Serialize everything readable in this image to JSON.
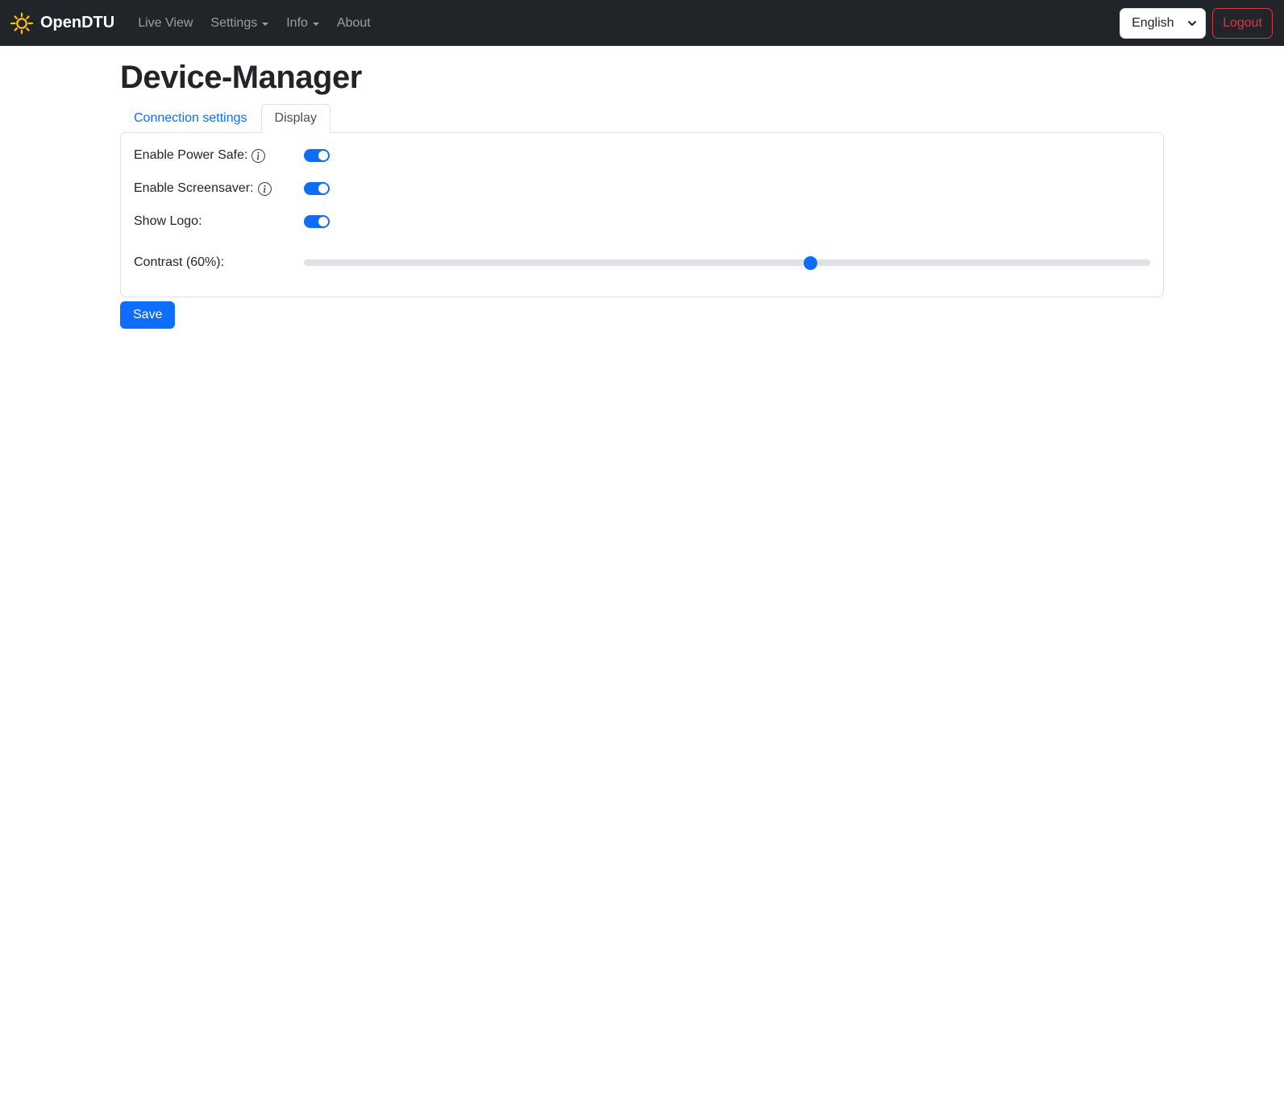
{
  "navbar": {
    "brand": "OpenDTU",
    "items": [
      {
        "label": "Live View",
        "dropdown": false
      },
      {
        "label": "Settings",
        "dropdown": true
      },
      {
        "label": "Info",
        "dropdown": true
      },
      {
        "label": "About",
        "dropdown": false
      }
    ],
    "language": {
      "selected": "English"
    },
    "logout_label": "Logout"
  },
  "page": {
    "title": "Device-Manager"
  },
  "tabs": [
    {
      "label": "Connection settings",
      "active": false
    },
    {
      "label": "Display",
      "active": true
    }
  ],
  "form": {
    "fields": [
      {
        "label": "Enable Power Safe:",
        "type": "switch",
        "value": true,
        "has_info": true
      },
      {
        "label": "Enable Screensaver:",
        "type": "switch",
        "value": true,
        "has_info": true
      },
      {
        "label": "Show Logo:",
        "type": "switch",
        "value": true,
        "has_info": false
      },
      {
        "label": "Contrast (60%):",
        "type": "range",
        "value": 60,
        "min": 0,
        "max": 100
      }
    ],
    "save_label": "Save"
  },
  "icons": {
    "brand": "sun-icon",
    "nav_dropdown": "chevron-down-icon",
    "field_help": "info-circle-icon"
  },
  "colors": {
    "accent": "#0d6efd",
    "danger": "#dc3545",
    "navbar_bg": "#212529",
    "border": "#dee2e6",
    "text": "#212529",
    "sun": "#ffc107"
  }
}
